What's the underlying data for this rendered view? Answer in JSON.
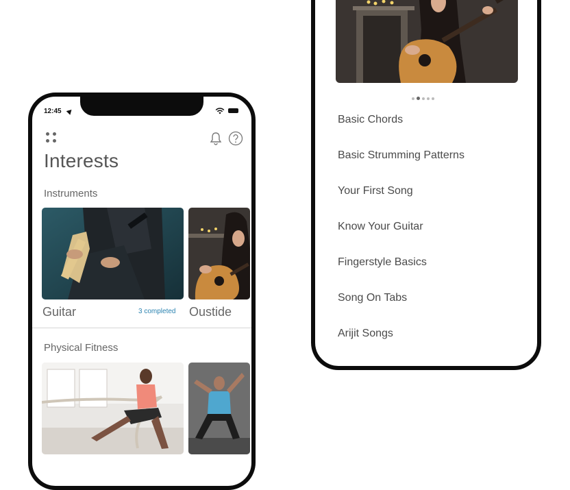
{
  "left_phone": {
    "status": {
      "time": "12:45"
    },
    "title": "Interests",
    "sections": [
      {
        "label": "Instruments",
        "cards": [
          {
            "name": "Guitar",
            "badge": "3 completed"
          },
          {
            "name": "Oustide"
          }
        ]
      },
      {
        "label": "Physical Fitness",
        "cards": [
          {
            "name": ""
          },
          {
            "name": ""
          }
        ]
      }
    ]
  },
  "right_phone": {
    "carousel": {
      "total": 5,
      "active_index": 1
    },
    "lessons": [
      "Basic Chords",
      "Basic Strumming Patterns",
      "Your First Song",
      "Know Your Guitar",
      "Fingerstyle Basics",
      "Song On Tabs",
      "Arijit Songs"
    ]
  },
  "colors": {
    "frame": "#0c0c0c",
    "text_primary": "#555555",
    "accent_link": "#2b83b0",
    "divider": "#d6d6d6"
  },
  "icons": [
    "grid-icon",
    "bell-icon",
    "help-icon",
    "wifi-icon",
    "battery-icon",
    "location-arrow-icon"
  ]
}
